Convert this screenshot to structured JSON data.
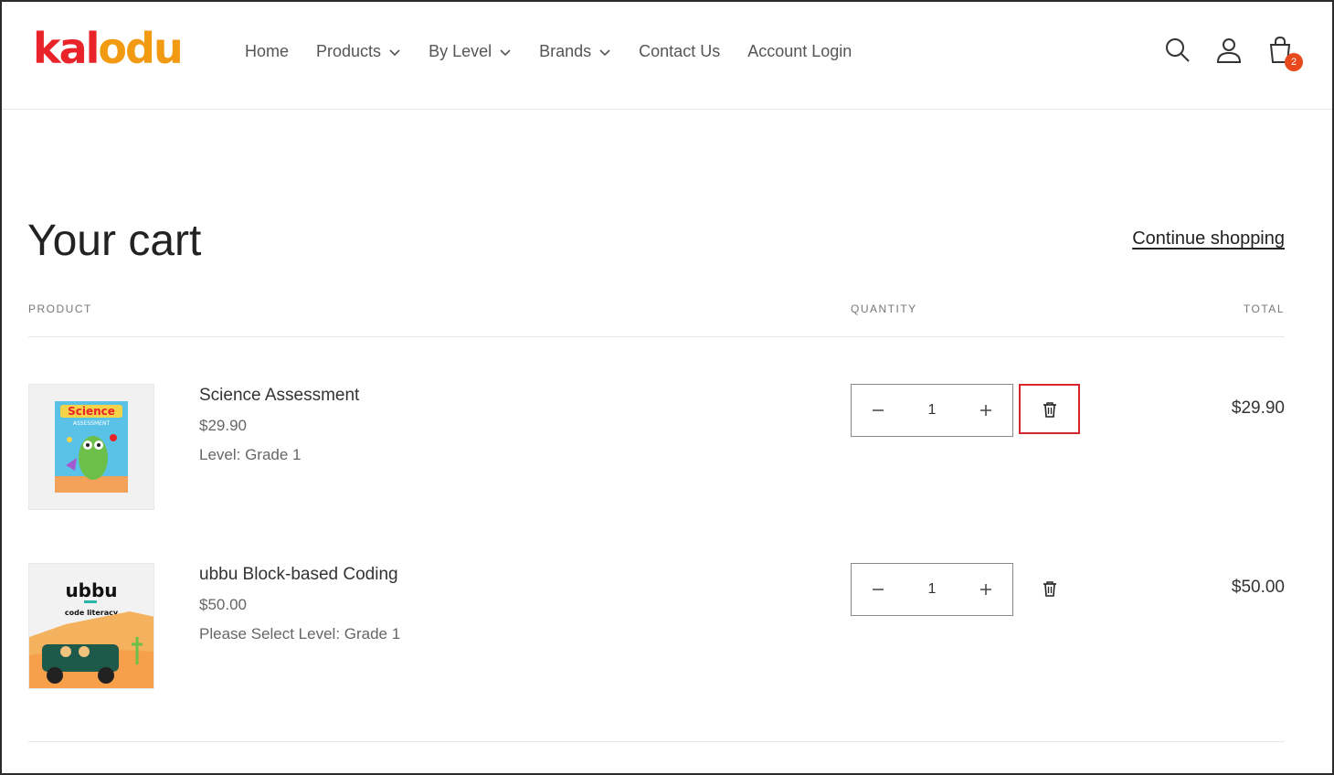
{
  "logo": {
    "k": "k",
    "a": "a",
    "l": "l",
    "o": "o",
    "d": "d",
    "u": "u"
  },
  "nav": [
    {
      "label": "Home",
      "dropdown": false
    },
    {
      "label": "Products",
      "dropdown": true
    },
    {
      "label": "By Level",
      "dropdown": true
    },
    {
      "label": "Brands",
      "dropdown": true
    },
    {
      "label": "Contact Us",
      "dropdown": false
    },
    {
      "label": "Account Login",
      "dropdown": false
    }
  ],
  "header_icons": {
    "search": "search-icon",
    "account": "account-icon",
    "cart": "cart-icon",
    "cart_count": "2"
  },
  "page": {
    "title": "Your cart",
    "continue_label": "Continue shopping",
    "columns": {
      "product": "PRODUCT",
      "quantity": "QUANTITY",
      "total": "TOTAL"
    }
  },
  "items": [
    {
      "name": "Science Assessment",
      "price": "$29.90",
      "option": "Level: Grade 1",
      "quantity": "1",
      "total": "$29.90",
      "thumb_text": "Science",
      "thumb_sub": "ASSESSMENT"
    },
    {
      "name": "ubbu Block-based Coding",
      "price": "$50.00",
      "option": "Please Select Level: Grade 1",
      "quantity": "1",
      "total": "$50.00",
      "thumb_text": "ubbu",
      "thumb_sub": "code literacy"
    }
  ],
  "colors": {
    "accent": "#e8232a",
    "logo_secondary": "#f29a11",
    "badge": "#e8481c",
    "highlight": "#d9262c"
  }
}
